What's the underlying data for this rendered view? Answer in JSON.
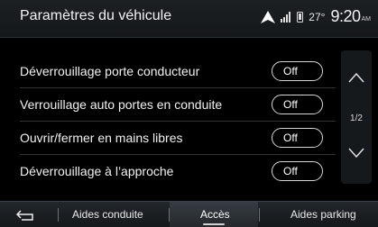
{
  "header": {
    "title": "Paramètres du véhicule",
    "temperature": "27°",
    "time": "9:20",
    "ampm": "AM"
  },
  "settings": [
    {
      "label": "Déverrouillage porte conducteur",
      "value": "Off"
    },
    {
      "label": "Verrouillage auto portes en conduite",
      "value": "Off"
    },
    {
      "label": "Ouvrir/fermer en mains libres",
      "value": "Off"
    },
    {
      "label": "Déverrouillage à l’approche",
      "value": "Off"
    }
  ],
  "pagination": {
    "page": "1/2"
  },
  "tabs": {
    "aides_conduite": "Aides conduite",
    "acces": "Accès",
    "aides_parking": "Aides parking"
  },
  "icons": {
    "navigation": "navigation-arrow-icon",
    "signal": "signal-icon",
    "phone": "phone-icon",
    "back": "back-arrow-icon",
    "up": "chevron-up-icon",
    "down": "chevron-down-icon"
  }
}
